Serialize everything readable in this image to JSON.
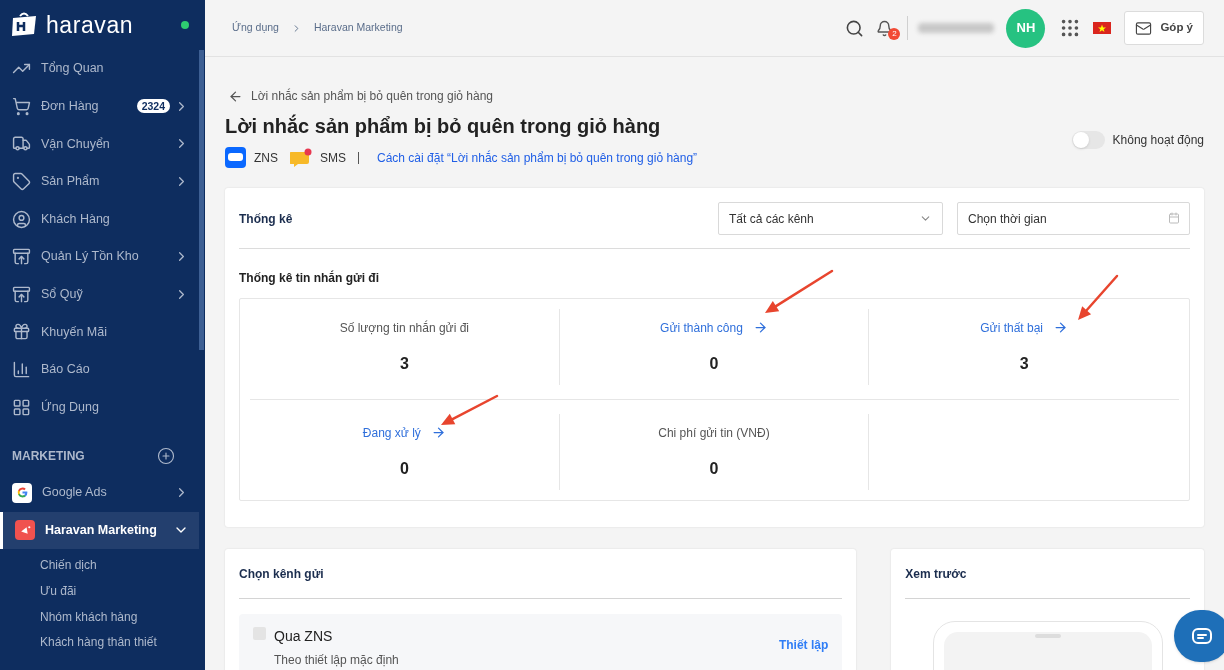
{
  "sidebar": {
    "logo": "haravan",
    "online": true,
    "items": [
      {
        "label": "Tổng Quan",
        "has_submenu": false
      },
      {
        "label": "Đơn Hàng",
        "badge": "2324",
        "has_submenu": true
      },
      {
        "label": "Vận Chuyển",
        "has_submenu": true
      },
      {
        "label": "Sản Phẩm",
        "has_submenu": true
      },
      {
        "label": "Khách Hàng",
        "has_submenu": false
      },
      {
        "label": "Quản Lý Tồn Kho",
        "has_submenu": true
      },
      {
        "label": "Sổ Quỹ",
        "has_submenu": true
      },
      {
        "label": "Khuyến Mãi",
        "has_submenu": false
      },
      {
        "label": "Báo Cáo",
        "has_submenu": false
      },
      {
        "label": "Ứng Dụng",
        "has_submenu": false
      }
    ],
    "section": "MARKETING",
    "apps": [
      {
        "label": "Google Ads",
        "selected": false,
        "expanded": false
      },
      {
        "label": "Haravan Marketing",
        "selected": true,
        "expanded": true
      }
    ],
    "sub_items": [
      "Chiến dịch",
      "Ưu đãi",
      "Nhóm khách hàng",
      "Khách hàng thân thiết"
    ]
  },
  "header": {
    "breadcrumb": [
      "Ứng dụng",
      "Haravan Marketing"
    ],
    "notifications": "2",
    "avatar": "NH",
    "feedback": "Góp ý"
  },
  "page": {
    "back_label": "Lời nhắc sản phẩm bị bỏ quên trong giỏ hàng",
    "title": "Lời nhắc sản phẩm bị bỏ quên trong giỏ hàng",
    "channels": [
      {
        "kind": "zalo",
        "label": "ZNS"
      },
      {
        "kind": "sms",
        "label": "SMS"
      }
    ],
    "guide_link": "Cách cài đặt “Lời nhắc sản phẩm bị bỏ quên trong giỏ hàng”",
    "status": {
      "label": "Không hoạt động",
      "on": false
    }
  },
  "stats": {
    "title": "Thống kê",
    "channel_select": "Tất cả các kênh",
    "time_placeholder": "Chọn thời gian",
    "subtitle": "Thống kê tin nhắn gửi đi",
    "metrics": [
      {
        "label": "Số lượng tin nhắn gửi đi",
        "value": "3",
        "link": false
      },
      {
        "label": "Gửi thành công",
        "value": "0",
        "link": true
      },
      {
        "label": "Gửi thất bại",
        "value": "3",
        "link": true
      },
      {
        "label": "Đang xử lý",
        "value": "0",
        "link": true
      },
      {
        "label": "Chi phí gửi tin (VNĐ)",
        "value": "0",
        "link": false
      }
    ]
  },
  "send_channel": {
    "title": "Chọn kênh gửi",
    "options": [
      {
        "label": "Qua ZNS",
        "description": "Theo thiết lập mặc định",
        "checked": false,
        "action": "Thiết lập"
      }
    ]
  },
  "preview": {
    "title": "Xem trước"
  }
}
